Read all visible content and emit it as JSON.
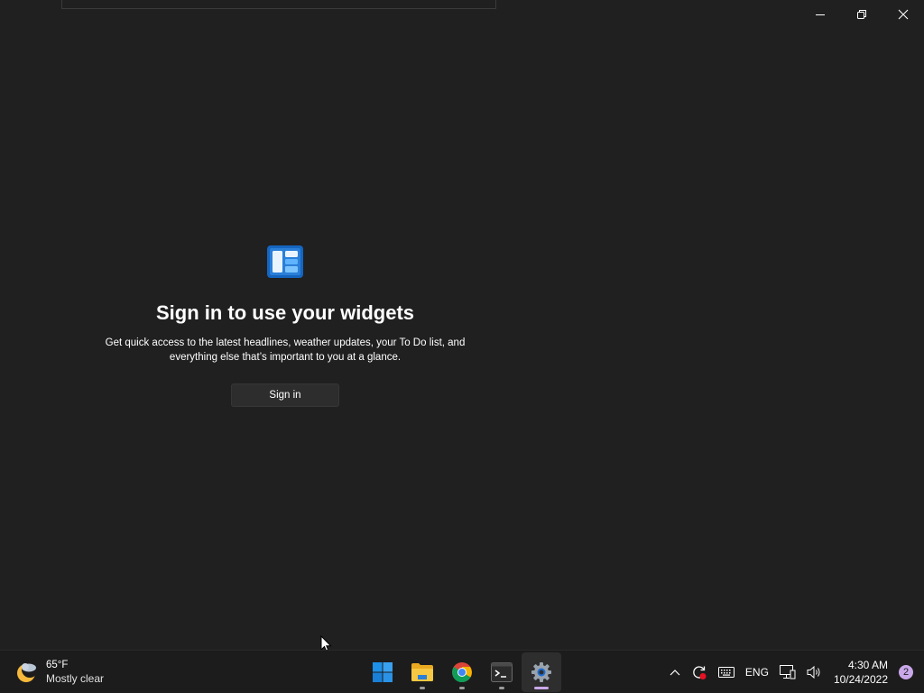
{
  "widgets": {
    "headline": "Sign in to use your widgets",
    "description": "Get quick access to the latest headlines, weather updates, your To Do list, and everything else that’s important to you at a glance.",
    "signin_label": "Sign in"
  },
  "window_controls": {
    "minimize_icon": "minimize-icon",
    "restore_icon": "restore-icon",
    "close_icon": "close-icon"
  },
  "taskbar": {
    "weather": {
      "temperature": "65°F",
      "condition": "Mostly clear",
      "icon": "moon-cloud-icon"
    },
    "apps": [
      {
        "name": "Start",
        "icon": "windows-start-icon"
      },
      {
        "name": "File Explorer",
        "icon": "folder-icon"
      },
      {
        "name": "Google Chrome",
        "icon": "chrome-icon"
      },
      {
        "name": "Terminal",
        "icon": "terminal-icon"
      },
      {
        "name": "Settings",
        "icon": "gear-icon"
      }
    ],
    "tray": {
      "language": "ENG",
      "time": "4:30 AM",
      "date": "10/24/2022",
      "notification_count": "2"
    }
  },
  "colors": {
    "background": "#202020",
    "taskbar": "#1c1c1c",
    "accent": "#c9a8ea"
  }
}
